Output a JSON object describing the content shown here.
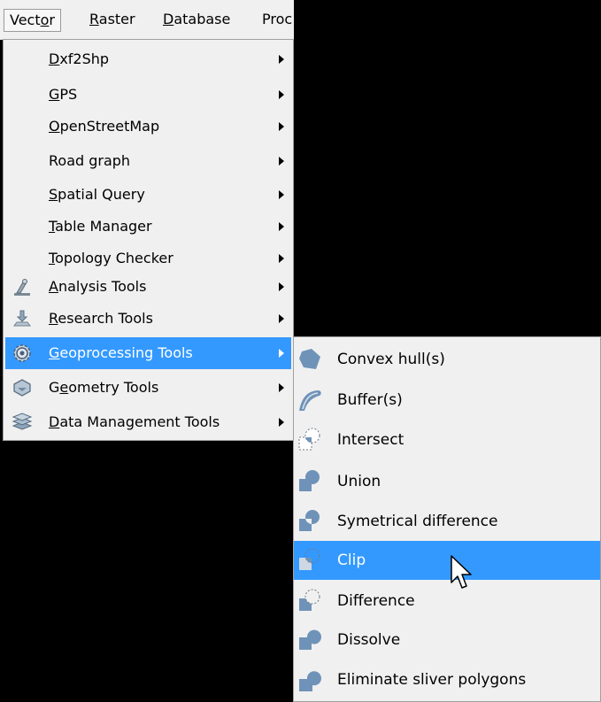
{
  "menubar": {
    "items": [
      {
        "pre": "Vect",
        "u": "o",
        "post": "r"
      },
      {
        "pre": "",
        "u": "R",
        "post": "aster"
      },
      {
        "pre": "",
        "u": "D",
        "post": "atabase"
      },
      {
        "pre": "Proc",
        "u": "",
        "post": ""
      }
    ]
  },
  "vector_menu": {
    "items": [
      {
        "pre": "",
        "u": "D",
        "post": "xf2Shp"
      },
      {
        "pre": "",
        "u": "G",
        "post": "PS"
      },
      {
        "pre": "",
        "u": "O",
        "post": "penStreetMap"
      },
      {
        "pre": "Road graph",
        "u": "",
        "post": ""
      },
      {
        "pre": "",
        "u": "S",
        "post": "patial Query"
      },
      {
        "pre": "",
        "u": "T",
        "post": "able Manager"
      },
      {
        "pre": "",
        "u": "T",
        "post": "opology Checker"
      },
      {
        "pre": "",
        "u": "A",
        "post": "nalysis Tools"
      },
      {
        "pre": "",
        "u": "R",
        "post": "esearch Tools"
      },
      {
        "pre": "",
        "u": "G",
        "post": "eoprocessing Tools"
      },
      {
        "pre": "G",
        "u": "e",
        "post": "ometry Tools"
      },
      {
        "pre": "",
        "u": "D",
        "post": "ata Management Tools"
      }
    ]
  },
  "geoprocessing_menu": {
    "items": [
      "Convex hull(s)",
      "Buffer(s)",
      "Intersect",
      "Union",
      "Symetrical difference",
      "Clip",
      "Difference",
      "Dissolve",
      "Eliminate sliver polygons"
    ]
  },
  "colors": {
    "highlight": "#3399ff",
    "menu_bg": "#f0f0f0",
    "icon_fill": "#6f93b8"
  }
}
